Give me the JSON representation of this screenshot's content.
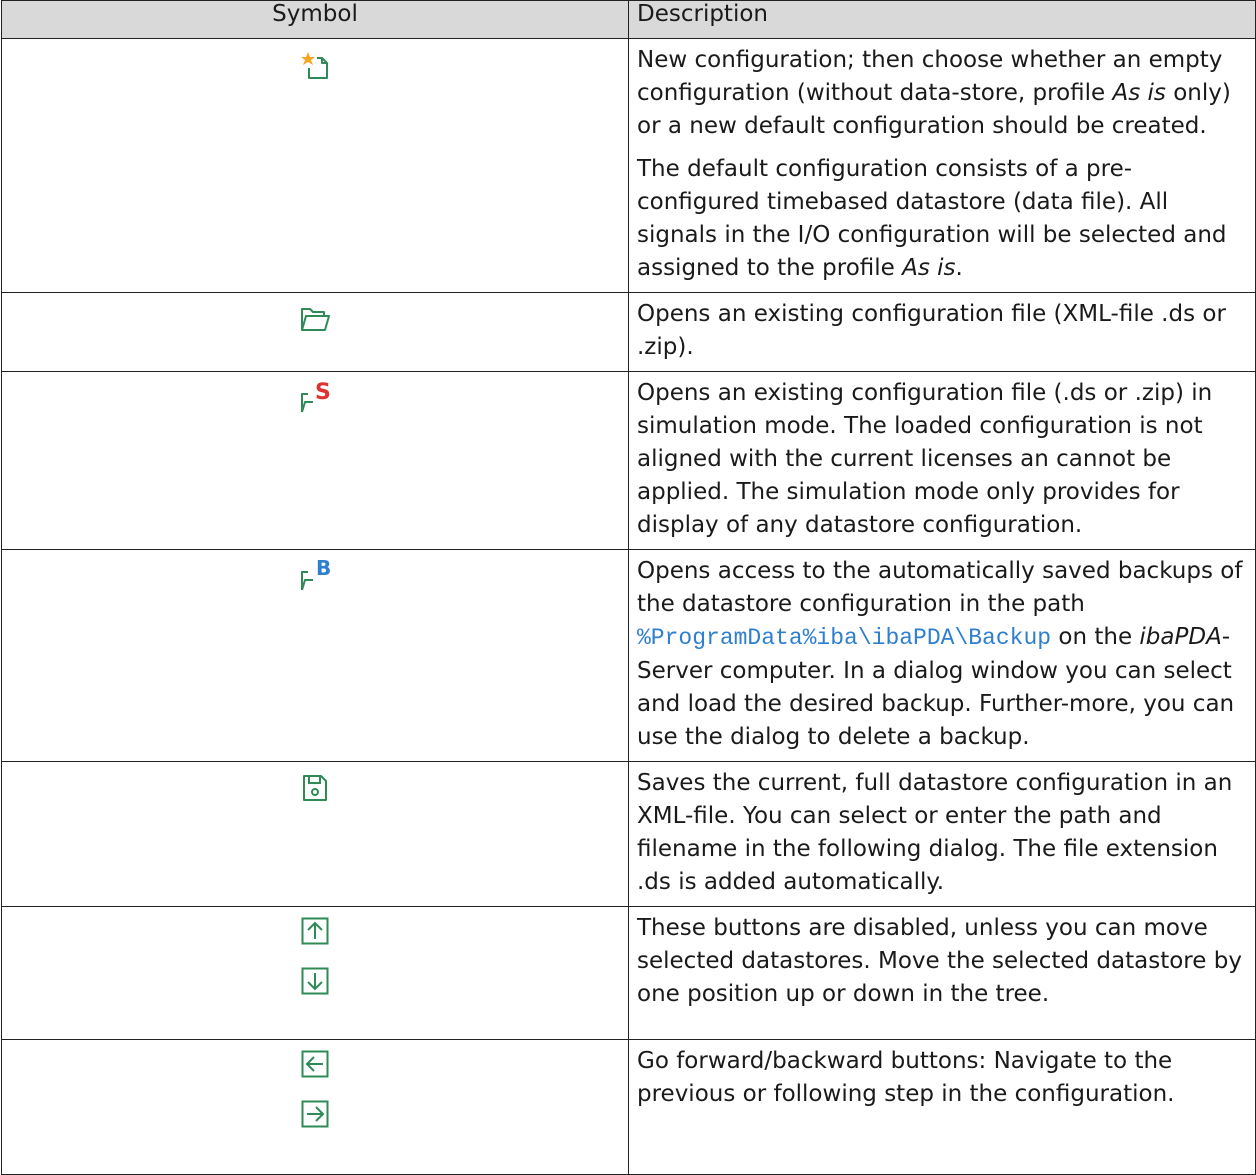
{
  "header": {
    "symbol": "Symbol",
    "description": "Description"
  },
  "rows": [
    {
      "icon": "new-configuration-icon",
      "p1": "New configuration; then choose whether an empty configuration (without data-store, profile ",
      "p1_em": "As is",
      "p1_end": " only) or a new default configuration should be created.",
      "p2": "The default configuration consists of a pre-configured timebased datastore (data file). All signals in the I/O configuration will be selected and assigned to the profile ",
      "p2_em": "As is",
      "p2_end": "."
    },
    {
      "icon": "open-folder-icon",
      "text": "Opens an existing configuration file (XML-file .ds or .zip)."
    },
    {
      "icon": "open-simulation-icon",
      "badge": "S",
      "text": "Opens an existing configuration file (.ds or .zip) in simulation mode. The loaded configuration is not aligned with the current licenses an cannot be applied. The simulation mode only provides for display of any datastore configuration."
    },
    {
      "icon": "open-backup-icon",
      "badge": "B",
      "t1": "Opens access to the automatically saved backups of the datastore configuration in the path ",
      "path": "%ProgramData%iba\\ibaPDA\\Backup",
      "t2": " on the ",
      "em": "ibaPDA",
      "t3": "-Server computer. In a dialog window you can select and load the desired backup. Further-more, you can use the dialog to delete a backup."
    },
    {
      "icon": "save-icon",
      "text": "Saves the current, full datastore configuration in an XML-file. You can select or enter the path and filename in the following dialog. The file extension .ds is added automatically."
    },
    {
      "icons": [
        "arrow-up-icon",
        "arrow-down-icon"
      ],
      "text": "These buttons are disabled, unless you can move selected datastores. Move the selected datastore by one position up or down in the tree."
    },
    {
      "icons": [
        "arrow-left-icon",
        "arrow-right-icon"
      ],
      "text": "Go forward/backward buttons: Navigate to the previous or following step in the configuration."
    }
  ],
  "colors": {
    "header_bg": "#d9d9d9",
    "icon_green": "#2e8b57",
    "star": "#f5a623",
    "simulation_red": "#e03131",
    "backup_blue": "#2f7fd0",
    "path_blue": "#2f7fd0"
  }
}
